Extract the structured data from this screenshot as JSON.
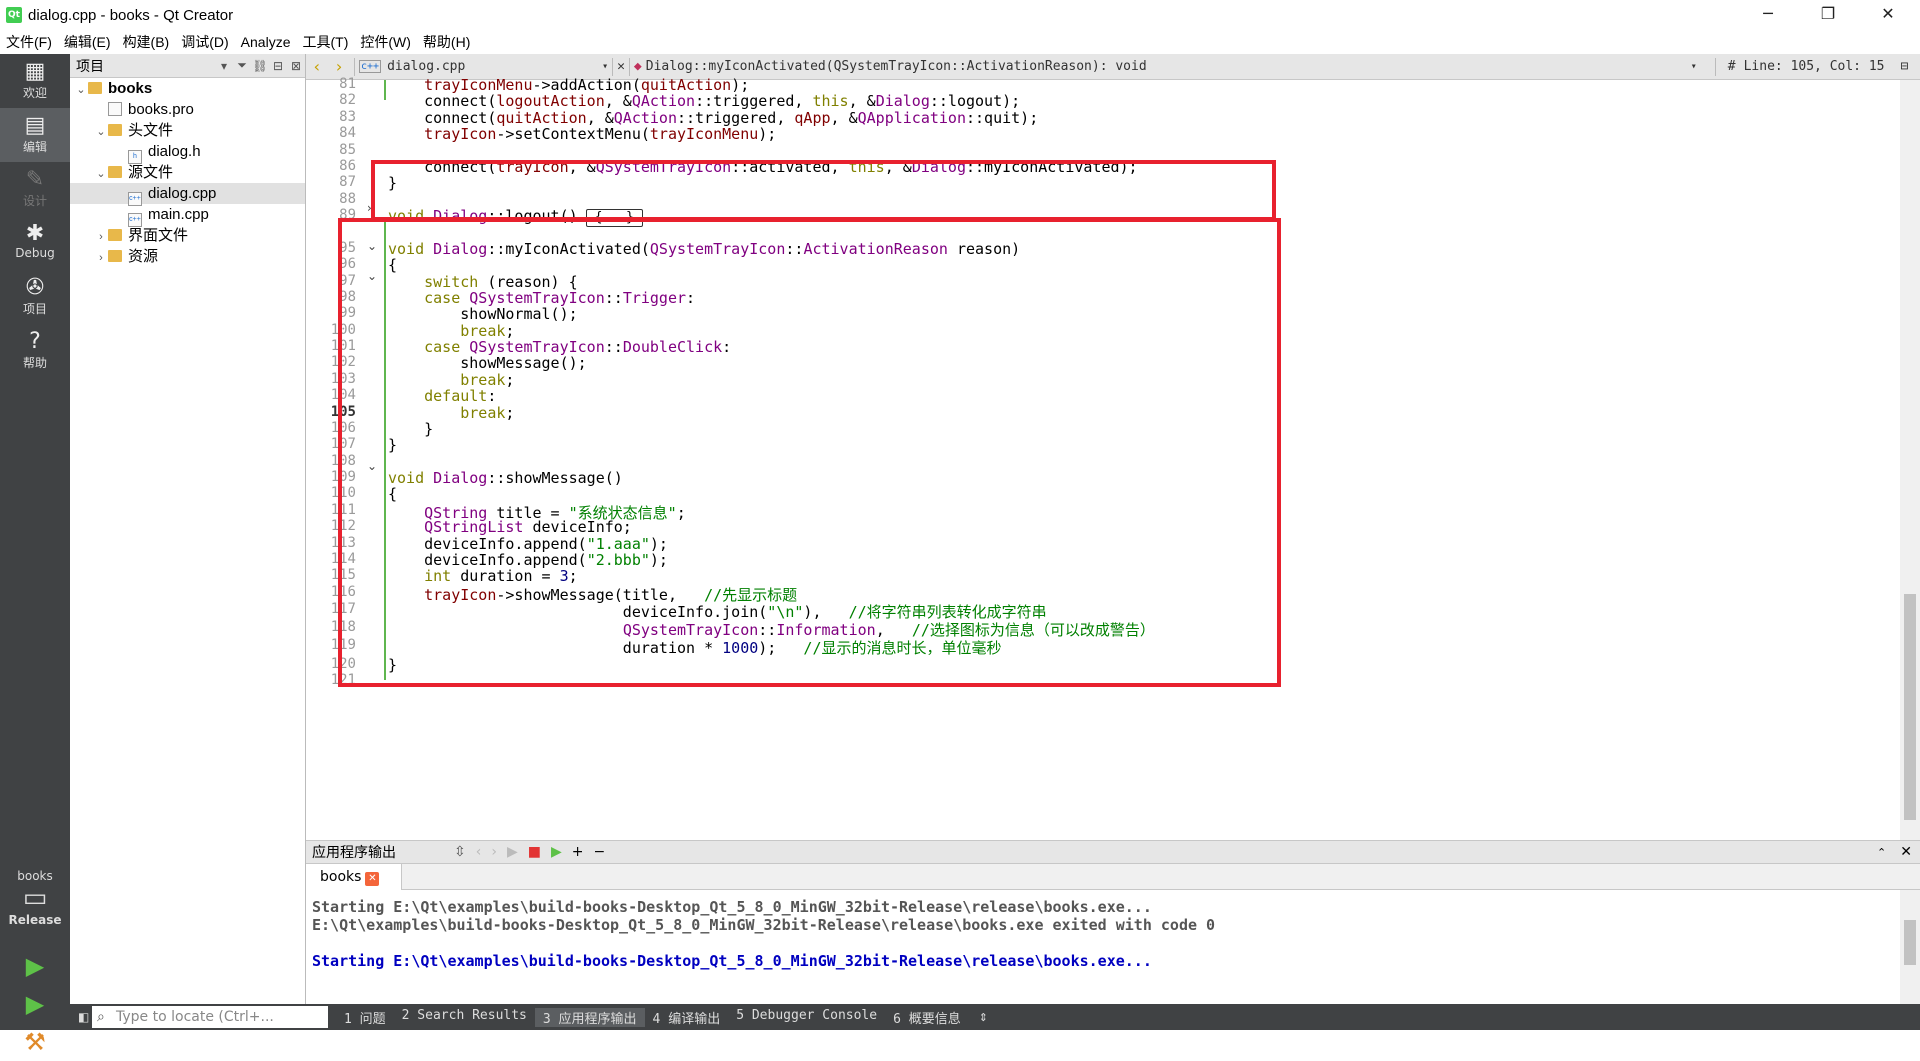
{
  "window": {
    "title": "dialog.cpp - books - Qt Creator",
    "minimize": "─",
    "restore": "❐",
    "close": "✕"
  },
  "menubar": [
    "文件(F)",
    "编辑(E)",
    "构建(B)",
    "调试(D)",
    "Analyze",
    "工具(T)",
    "控件(W)",
    "帮助(H)"
  ],
  "modes": [
    {
      "label": "欢迎",
      "icon": "grid-icon"
    },
    {
      "label": "编辑",
      "icon": "edit-icon"
    },
    {
      "label": "设计",
      "icon": "pencil-icon"
    },
    {
      "label": "Debug",
      "icon": "bug-icon"
    },
    {
      "label": "项目",
      "icon": "wrench-icon"
    },
    {
      "label": "帮助",
      "icon": "help-icon"
    }
  ],
  "kit": {
    "project": "books",
    "config": "Release"
  },
  "project_panel": {
    "title": "项目",
    "tree": [
      {
        "label": "books",
        "level": 0,
        "expanded": true,
        "kind": "project"
      },
      {
        "label": "books.pro",
        "level": 1,
        "kind": "pro"
      },
      {
        "label": "头文件",
        "level": 1,
        "expanded": true,
        "kind": "folder"
      },
      {
        "label": "dialog.h",
        "level": 2,
        "kind": "h"
      },
      {
        "label": "源文件",
        "level": 1,
        "expanded": true,
        "kind": "folder"
      },
      {
        "label": "dialog.cpp",
        "level": 2,
        "kind": "cpp",
        "selected": true
      },
      {
        "label": "main.cpp",
        "level": 2,
        "kind": "cpp"
      },
      {
        "label": "界面文件",
        "level": 1,
        "expanded": false,
        "kind": "folder"
      },
      {
        "label": "资源",
        "level": 1,
        "expanded": false,
        "kind": "folder"
      }
    ]
  },
  "editor_toolbar": {
    "file": "dialog.cpp",
    "symbol": "Dialog::myIconActivated(QSystemTrayIcon::ActivationReason): void",
    "hash": "#",
    "position": "Line: 105, Col: 15"
  },
  "editor": {
    "current_line": "105",
    "lines": [
      {
        "n": "81",
        "code": "    trayIconMenu->addAction(quitAction);"
      },
      {
        "n": "82",
        "code": "    connect(logoutAction, &QAction::triggered, this, &Dialog::logout);"
      },
      {
        "n": "83",
        "code": "    connect(quitAction, &QAction::triggered, qApp, &QApplication::quit);"
      },
      {
        "n": "84",
        "code": "    trayIcon->setContextMenu(trayIconMenu);"
      },
      {
        "n": "85",
        "code": ""
      },
      {
        "n": "86",
        "code": "    connect(trayIcon, &QSystemTrayIcon::activated, this, &Dialog::myIconActivated);"
      },
      {
        "n": "87",
        "code": "}"
      },
      {
        "n": "88",
        "code": ""
      },
      {
        "n": "89",
        "code": "void Dialog::logout()"
      },
      {
        "n": "95",
        "code": "void Dialog::myIconActivated(QSystemTrayIcon::ActivationReason reason)"
      },
      {
        "n": "96",
        "code": "{"
      },
      {
        "n": "97",
        "code": "    switch (reason) {"
      },
      {
        "n": "98",
        "code": "    case QSystemTrayIcon::Trigger:"
      },
      {
        "n": "99",
        "code": "        showNormal();"
      },
      {
        "n": "100",
        "code": "        break;"
      },
      {
        "n": "101",
        "code": "    case QSystemTrayIcon::DoubleClick:"
      },
      {
        "n": "102",
        "code": "        showMessage();"
      },
      {
        "n": "103",
        "code": "        break;"
      },
      {
        "n": "104",
        "code": "    default:"
      },
      {
        "n": "105",
        "code": "        break;"
      },
      {
        "n": "106",
        "code": "    }"
      },
      {
        "n": "107",
        "code": "}"
      },
      {
        "n": "108",
        "code": ""
      },
      {
        "n": "109",
        "code": "void Dialog::showMessage()"
      },
      {
        "n": "110",
        "code": "{"
      },
      {
        "n": "111",
        "code": "    QString title = \"系统状态信息\";"
      },
      {
        "n": "112",
        "code": "    QStringList deviceInfo;"
      },
      {
        "n": "113",
        "code": "    deviceInfo.append(\"1.aaa\");"
      },
      {
        "n": "114",
        "code": "    deviceInfo.append(\"2.bbb\");"
      },
      {
        "n": "115",
        "code": "    int duration = 3;"
      },
      {
        "n": "116",
        "code": "    trayIcon->showMessage(title,   //先显示标题"
      },
      {
        "n": "117",
        "code": "                          deviceInfo.join(\"\\n\"),   //将字符串列表转化成字符串"
      },
      {
        "n": "118",
        "code": "                          QSystemTrayIcon::Information,   //选择图标为信息（可以改成警告）"
      },
      {
        "n": "119",
        "code": "                          duration * 1000);   //显示的消息时长，单位毫秒"
      },
      {
        "n": "120",
        "code": "}"
      },
      {
        "n": "121",
        "code": ""
      }
    ],
    "collapsed_marker": "{...}"
  },
  "output": {
    "panel_title": "应用程序输出",
    "tab": "books",
    "lines": [
      "Starting E:\\Qt\\examples\\build-books-Desktop_Qt_5_8_0_MinGW_32bit-Release\\release\\books.exe...",
      "E:\\Qt\\examples\\build-books-Desktop_Qt_5_8_0_MinGW_32bit-Release\\release\\books.exe exited with code 0",
      "",
      "Starting E:\\Qt\\examples\\build-books-Desktop_Qt_5_8_0_MinGW_32bit-Release\\release\\books.exe..."
    ]
  },
  "statusbar": {
    "locate_placeholder": "Type to locate (Ctrl+...",
    "tabs": [
      "1 问题",
      "2 Search Results",
      "3 应用程序输出",
      "4 编译输出",
      "5 Debugger Console",
      "6 概要信息"
    ],
    "active_tab": 2
  },
  "colors": {
    "highlight_box": "#e8212e",
    "mode_bar": "#404244",
    "changed_line": "#5fb64f"
  }
}
